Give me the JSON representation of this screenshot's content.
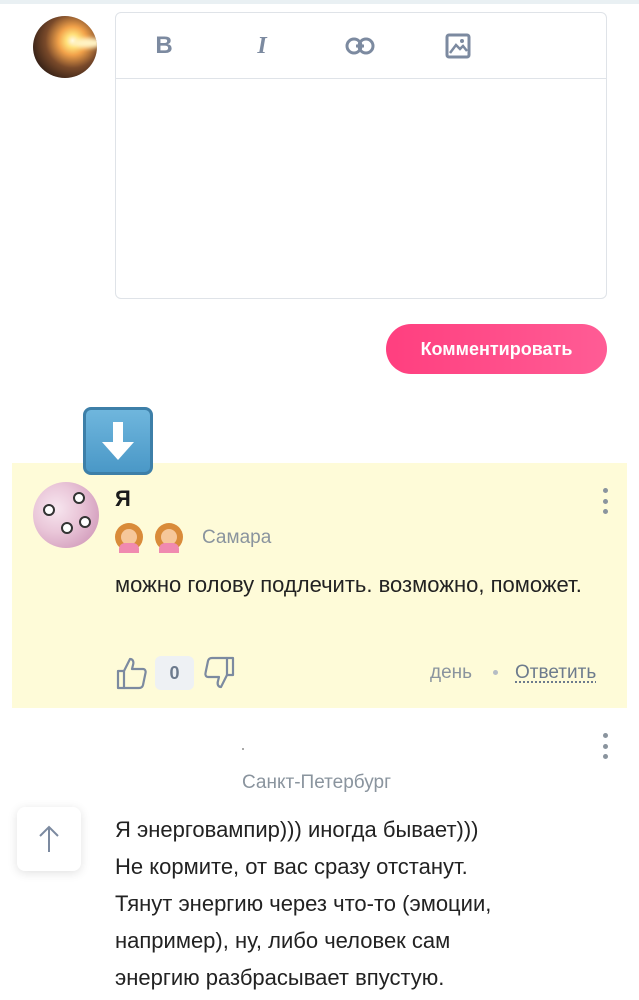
{
  "editor": {
    "toolbar": {
      "bold_label": "B",
      "italic_label": "I"
    },
    "placeholder": ""
  },
  "submit": {
    "label": "Комментировать"
  },
  "comments": [
    {
      "author": "Я",
      "city": "Самара",
      "text": "можно голову подлечить. возможно, поможет.",
      "likes": "0",
      "time": "день",
      "reply_label": "Ответить",
      "highlighted": true
    },
    {
      "city": "Санкт-Петербург",
      "text_lines": [
        "Я энерговампир))) иногда бывает)))",
        "Не кормите, от вас сразу отстанут.",
        "Тянут энергию через что-то (эмоции,",
        "например), ну, либо человек сам",
        "энергию разбрасывает впустую."
      ]
    }
  ],
  "colors": {
    "accent": "#ff4d8a",
    "highlight_bg": "#fefbd8",
    "muted_text": "#8a949e",
    "icon": "#7c8aa0"
  },
  "icons": {
    "bold": "bold-icon",
    "italic": "italic-icon",
    "link": "link-icon",
    "image": "image-icon",
    "down_arrow": "down-arrow-icon",
    "like": "thumbs-up-icon",
    "dislike": "thumbs-down-icon",
    "menu": "more-vertical-icon",
    "scroll_top": "arrow-up-icon"
  }
}
